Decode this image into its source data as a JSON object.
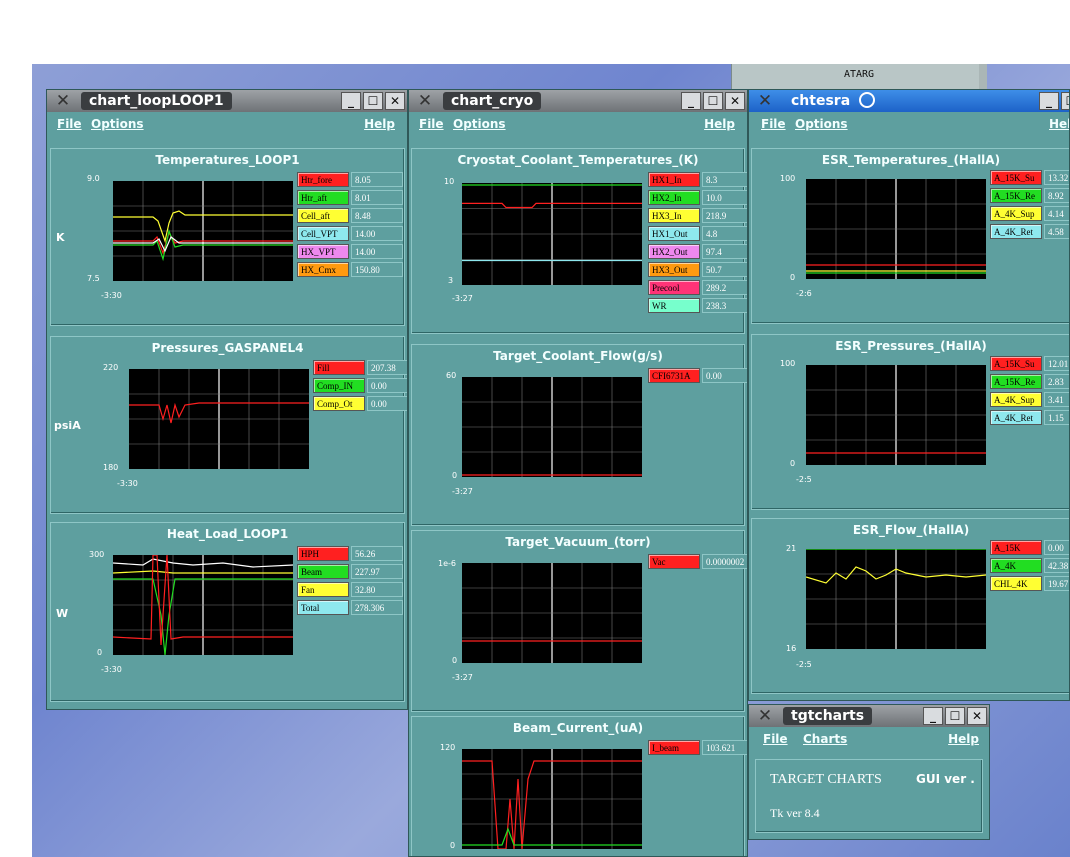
{
  "desktop": {
    "atarg_label": "ATARG"
  },
  "colors": {
    "red": "#ff2020",
    "green": "#22dd22",
    "yellow": "#ffff33",
    "white": "#ffffff",
    "cyan": "#8ee8ee",
    "magenta": "#ee88ee",
    "orange": "#ff9a10",
    "pink": "#ff3377",
    "aqua": "#77ffcc"
  },
  "menu": {
    "file": "File",
    "options": "Options",
    "help": "Help",
    "charts": "Charts"
  },
  "windows": {
    "loop": {
      "title": "chart_loopLOOP1"
    },
    "cryo": {
      "title": "chart_cryo"
    },
    "esr": {
      "title": "chtesra"
    },
    "tgt": {
      "title": "tgtcharts",
      "heading": "TARGET CHARTS",
      "gui": "GUI ver .",
      "tk": "Tk ver 8.4"
    }
  },
  "panels": [
    {
      "id": "p1",
      "title": "Temperatures_LOOP1",
      "ylabel": "K",
      "ymax": "9.0",
      "ymin": "7.5",
      "xtick": "-3:30",
      "legend": [
        {
          "name": "Htr_fore",
          "value": "8.05",
          "color": "#ff2020"
        },
        {
          "name": "Htr_aft",
          "value": "8.01",
          "color": "#22dd22"
        },
        {
          "name": "Cell_aft",
          "value": "8.48",
          "color": "#ffff33"
        },
        {
          "name": "Cell_VPT",
          "value": "14.00",
          "color": "#8ee8ee"
        },
        {
          "name": "HX_VPT",
          "value": "14.00",
          "color": "#ee88ee"
        },
        {
          "name": "HX_Cmx",
          "value": "150.80",
          "color": "#ff9a10"
        }
      ]
    },
    {
      "id": "p2",
      "title": "Pressures_GASPANEL4",
      "ylabel": "psiA",
      "ymax": "220",
      "ymin": "180",
      "xtick": "-3:30",
      "legend": [
        {
          "name": "Fill",
          "value": "207.38",
          "color": "#ff2020"
        },
        {
          "name": "Comp_IN",
          "value": "0.00",
          "color": "#22dd22"
        },
        {
          "name": "Comp_Ot",
          "value": "0.00",
          "color": "#ffff33"
        }
      ]
    },
    {
      "id": "p3",
      "title": "Heat_Load_LOOP1",
      "ylabel": "W",
      "ymax": "300",
      "ymin": "0",
      "xtick": "-3:30",
      "legend": [
        {
          "name": "HPH",
          "value": "56.26",
          "color": "#ff2020"
        },
        {
          "name": "Beam",
          "value": "227.97",
          "color": "#22dd22"
        },
        {
          "name": "Fan",
          "value": "32.80",
          "color": "#ffff33"
        },
        {
          "name": "Total",
          "value": "278.306",
          "color": "#8ee8ee"
        }
      ]
    },
    {
      "id": "p4",
      "title": "Cryostat_Coolant_Temperatures_(K)",
      "ylabel": "",
      "ymax": "10",
      "ymin": "3",
      "xtick": "-3:27",
      "legend": [
        {
          "name": "HX1_In",
          "value": "8.3",
          "color": "#ff2020"
        },
        {
          "name": "HX2_In",
          "value": "10.0",
          "color": "#22dd22"
        },
        {
          "name": "HX3_In",
          "value": "218.9",
          "color": "#ffff33"
        },
        {
          "name": "HX1_Out",
          "value": "4.8",
          "color": "#8ee8ee"
        },
        {
          "name": "HX2_Out",
          "value": "97.4",
          "color": "#ee88ee"
        },
        {
          "name": "HX3_Out",
          "value": "50.7",
          "color": "#ff9a10"
        },
        {
          "name": "Precool",
          "value": "289.2",
          "color": "#ff3377"
        },
        {
          "name": "WR",
          "value": "238.3",
          "color": "#77ffcc"
        }
      ]
    },
    {
      "id": "p5",
      "title": "Target_Coolant_Flow(g/s)",
      "ylabel": "",
      "ymax": "60",
      "ymin": "0",
      "xtick": "-3:27",
      "legend": [
        {
          "name": "CFI6731A",
          "value": "0.00",
          "color": "#ff2020"
        }
      ]
    },
    {
      "id": "p6",
      "title": "Target_Vacuum_(torr)",
      "ylabel": "",
      "ymax": "1e-6",
      "ymin": "0",
      "xtick": "-3:27",
      "legend": [
        {
          "name": "Vac",
          "value": "0.0000002",
          "color": "#ff2020"
        }
      ]
    },
    {
      "id": "p7",
      "title": "Beam_Current_(uA)",
      "ylabel": "",
      "ymax": "120",
      "ymin": "0",
      "xtick": "",
      "legend": [
        {
          "name": "I_beam",
          "value": "103.621",
          "color": "#ff2020"
        }
      ]
    },
    {
      "id": "p8",
      "title": "ESR_Temperatures_(HallA)",
      "ylabel": "",
      "ymax": "100",
      "ymin": "0",
      "xtick": "-2:6",
      "legend": [
        {
          "name": "A_15K_Su",
          "value": "13.32",
          "color": "#ff2020"
        },
        {
          "name": "A_15K_Re",
          "value": "8.92",
          "color": "#22dd22"
        },
        {
          "name": "A_4K_Sup",
          "value": "4.14",
          "color": "#ffff33"
        },
        {
          "name": "A_4K_Ret",
          "value": "4.58",
          "color": "#8ee8ee"
        }
      ]
    },
    {
      "id": "p9",
      "title": "ESR_Pressures_(HallA)",
      "ylabel": "",
      "ymax": "100",
      "ymin": "0",
      "xtick": "-2:5",
      "legend": [
        {
          "name": "A_15K_Su",
          "value": "12.01",
          "color": "#ff2020"
        },
        {
          "name": "A_15K_Re",
          "value": "2.83",
          "color": "#22dd22"
        },
        {
          "name": "A_4K_Sup",
          "value": "3.41",
          "color": "#ffff33"
        },
        {
          "name": "A_4K_Ret",
          "value": "1.15",
          "color": "#8ee8ee"
        }
      ]
    },
    {
      "id": "p10",
      "title": "ESR_Flow_(HallA)",
      "ylabel": "",
      "ymax": "21",
      "ymin": "16",
      "xtick": "-2:5",
      "legend": [
        {
          "name": "A_15K",
          "value": "0.00",
          "color": "#ff2020"
        },
        {
          "name": "A_4K",
          "value": "42.38",
          "color": "#22dd22"
        },
        {
          "name": "CHL_4K",
          "value": "19.67",
          "color": "#ffff33"
        }
      ]
    }
  ]
}
